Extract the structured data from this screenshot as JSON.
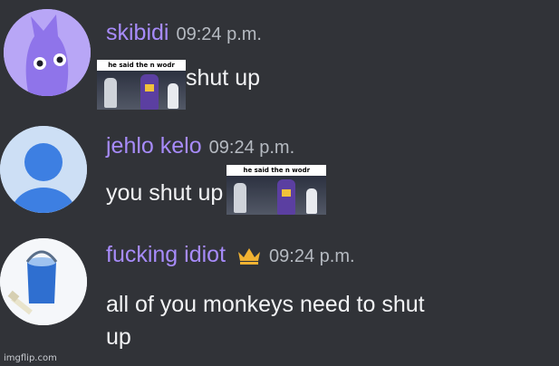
{
  "messages": [
    {
      "username": "skibidi",
      "timestamp": "09:24 p.m.",
      "sticker_caption": "he said the n wodr",
      "text": "shut up",
      "avatar": "purple-creature-avatar"
    },
    {
      "username": "jehlo kelo",
      "timestamp": "09:24 p.m.",
      "text": "you shut up",
      "sticker_caption": "he said the n wodr",
      "avatar": "default-person-avatar"
    },
    {
      "username": "fucking idiot",
      "timestamp": "09:24 p.m.",
      "badge": "crown-icon",
      "text_line1": "all of you monkeys need to shut",
      "text_line2": "up",
      "avatar": "paint-bucket-avatar"
    }
  ],
  "watermark": "imgflip.com",
  "colors": {
    "background": "#313338",
    "username": "#a78bfa",
    "timestamp": "#b5bac1",
    "text": "#f2f3f5",
    "crown": "#f0b232"
  }
}
